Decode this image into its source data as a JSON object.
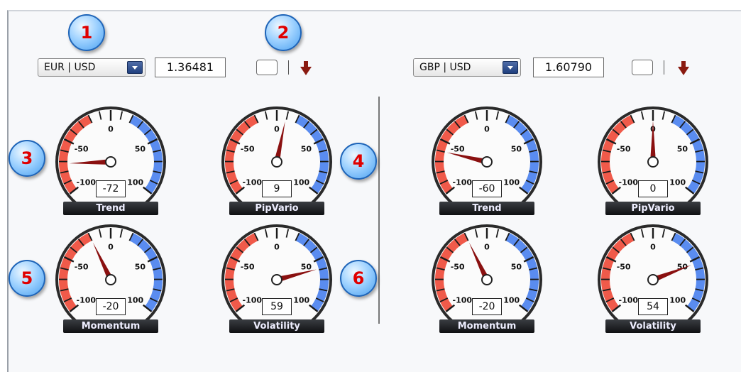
{
  "pairs": [
    {
      "symbol": "EUR | USD",
      "price": "1.36481",
      "gauges": [
        {
          "name": "Trend",
          "value": "-72"
        },
        {
          "name": "PipVario",
          "value": "9"
        },
        {
          "name": "Momentum",
          "value": "-20"
        },
        {
          "name": "Volatility",
          "value": "59"
        }
      ]
    },
    {
      "symbol": "GBP | USD",
      "price": "1.60790",
      "gauges": [
        {
          "name": "Trend",
          "value": "-60"
        },
        {
          "name": "PipVario",
          "value": "0"
        },
        {
          "name": "Momentum",
          "value": "-20"
        },
        {
          "name": "Volatility",
          "value": "54"
        }
      ]
    }
  ],
  "scale_labels": {
    "neg100": "-100",
    "neg50": "-50",
    "zero": "0",
    "pos50": "50",
    "pos100": "100"
  },
  "badges": [
    "1",
    "2",
    "3",
    "4",
    "5",
    "6"
  ],
  "colors": {
    "negative_zone": "#f05a4a",
    "positive_zone": "#5a8cf0",
    "needle": "#8a1010",
    "down_arrow": "#8a1a10"
  },
  "icons": {
    "direction": "arrow-down-icon",
    "dropdown": "chevron-down-icon"
  }
}
